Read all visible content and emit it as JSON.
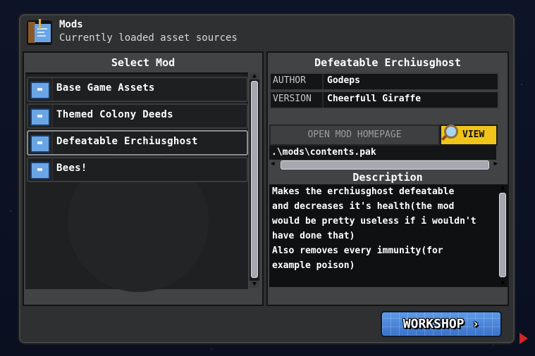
{
  "window": {
    "title": "Mods",
    "subtitle": "Currently loaded asset sources"
  },
  "left_panel": {
    "heading": "Select Mod",
    "mods": [
      {
        "name": "Base Game Assets",
        "selected": false
      },
      {
        "name": "Themed Colony Deeds",
        "selected": false
      },
      {
        "name": "Defeatable Erchiusghost",
        "selected": true
      },
      {
        "name": "Bees!",
        "selected": false
      }
    ]
  },
  "details": {
    "heading": "Defeatable Erchiusghost",
    "author_label": "AUTHOR",
    "author": "Godeps",
    "version_label": "VERSION",
    "version": "Cheerfull Giraffe",
    "homepage_button": "OPEN MOD HOMEPAGE",
    "view_button": "VIEW",
    "path": ".\\mods\\contents.pak",
    "description_heading": "Description",
    "description": "Makes the erchiusghost defeatable\nand decreases it's health(the mod\nwould be pretty useless if i wouldn't\nhave done that)\nAlso removes every immunity(for\nexample poison)"
  },
  "footer": {
    "workshop_button": "WORKSHOP",
    "workshop_arrow": "›"
  },
  "icons": {
    "scroll_up": "▲",
    "scroll_down": "▼",
    "scroll_left": "◀",
    "scroll_right": "▶"
  },
  "colors": {
    "accent_blue": "#4a86dc",
    "view_yellow": "#f0c419",
    "cursor_red": "#d32626"
  }
}
